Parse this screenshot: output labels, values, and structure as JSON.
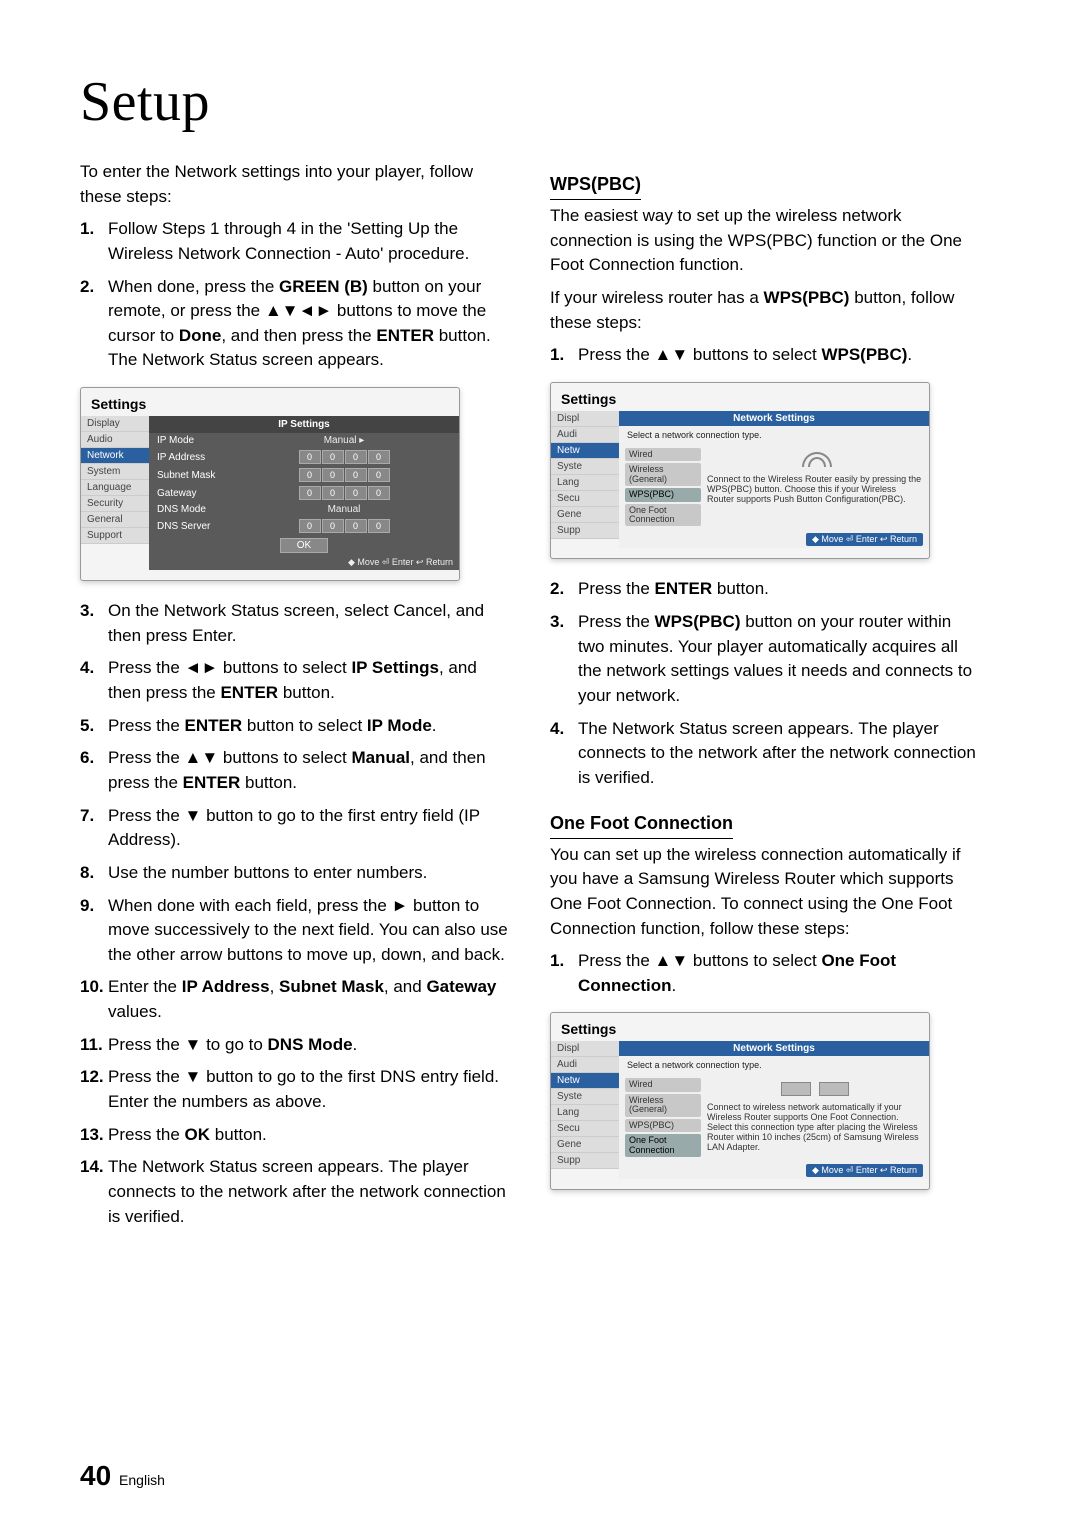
{
  "title": "Setup",
  "footer": {
    "page": "40",
    "lang": "English"
  },
  "left": {
    "intro": "To enter the Network settings into your player, follow these steps:",
    "steps_before": [
      "Follow Steps 1 through 4 in the 'Setting Up the Wireless Network Connection - Auto' procedure.",
      "When done, press the <b>GREEN (B)</b> button on your remote, or press the ▲▼◄► buttons to move the cursor to <b>Done</b>, and then press the <b>ENTER</b> button. The Network Status screen appears."
    ],
    "ip_panel": {
      "title": "Settings",
      "side": [
        "Display",
        "Audio",
        "Network",
        "System",
        "Language",
        "Security",
        "General",
        "Support"
      ],
      "active": 2,
      "pane_title": "IP Settings",
      "rows": [
        {
          "label": "IP Mode",
          "mode": "Manual ▸"
        },
        {
          "label": "IP Address",
          "vals": [
            "0",
            "0",
            "0",
            "0"
          ]
        },
        {
          "label": "Subnet Mask",
          "vals": [
            "0",
            "0",
            "0",
            "0"
          ]
        },
        {
          "label": "Gateway",
          "vals": [
            "0",
            "0",
            "0",
            "0"
          ]
        },
        {
          "label": "DNS Mode",
          "mode": "Manual"
        },
        {
          "label": "DNS Server",
          "vals": [
            "0",
            "0",
            "0",
            "0"
          ]
        }
      ],
      "ok": "OK",
      "hints": "◆ Move   ⏎ Enter   ↩ Return"
    },
    "steps_after": [
      "On the Network Status screen, select Cancel, and then press Enter.",
      "Press the ◄► buttons to select <b>IP Settings</b>, and then press the <b>ENTER</b> button.",
      "Press the <b>ENTER</b> button to select <b>IP Mode</b>.",
      "Press the ▲▼ buttons to select <b>Manual</b>, and then press the <b>ENTER</b> button.",
      "Press the ▼ button to go to the first entry field (IP Address).",
      "Use the number buttons to enter numbers.",
      "When done with each field, press the ► button to move successively to the next field. You can also use the other arrow buttons to move up, down, and back.",
      "Enter the <b>IP Address</b>, <b>Subnet Mask</b>, and <b>Gateway</b> values.",
      "Press the ▼ to go to <b>DNS Mode</b>.",
      "Press the ▼ button to go to the first DNS entry field. Enter the numbers as above.",
      "Press the <b>OK</b> button.",
      "The Network Status screen appears. The player connects to the network after the network connection is verified."
    ]
  },
  "right": {
    "wps": {
      "heading": "WPS(PBC)",
      "p1": "The easiest way to set up the wireless network connection is using the WPS(PBC) function or the One Foot Connection function.",
      "p2": "If your wireless router has a <b>WPS(PBC)</b> button, follow these steps:",
      "steps_before": [
        "Press the ▲▼ buttons to select <b>WPS(PBC)</b>."
      ],
      "panel": {
        "title": "Settings",
        "side": [
          "Displ",
          "Audi",
          "Netw",
          "Syste",
          "Lang",
          "Secu",
          "Gene",
          "Supp"
        ],
        "active": 2,
        "pane_title": "Network Settings",
        "sub": "Select a network connection type.",
        "items": [
          "Wired",
          "Wireless (General)",
          "WPS(PBC)",
          "One Foot Connection"
        ],
        "selected": 2,
        "desc": "Connect to the Wireless Router easily by pressing the WPS(PBC) button. Choose this if your Wireless Router supports Push Button Configuration(PBC).",
        "hints": "◆ Move   ⏎ Enter   ↩ Return"
      },
      "steps_after": [
        "Press the <b>ENTER</b> button.",
        "Press the <b>WPS(PBC)</b> button on your router within two minutes. Your player automatically acquires all the network settings values it needs and connects to your network.",
        "The Network Status screen appears. The player connects to the network after the network connection is verified."
      ]
    },
    "ofc": {
      "heading": "One Foot Connection",
      "p1": "You can set up the wireless connection automatically if you have a Samsung Wireless Router which supports One Foot Connection. To connect using the One Foot Connection function, follow these steps:",
      "steps_before": [
        "Press the ▲▼ buttons to select <b>One Foot Connection</b>."
      ],
      "panel": {
        "title": "Settings",
        "side": [
          "Displ",
          "Audi",
          "Netw",
          "Syste",
          "Lang",
          "Secu",
          "Gene",
          "Supp"
        ],
        "active": 2,
        "pane_title": "Network Settings",
        "sub": "Select a network connection type.",
        "items": [
          "Wired",
          "Wireless (General)",
          "WPS(PBC)",
          "One Foot Connection"
        ],
        "selected": 3,
        "desc": "Connect to wireless network automatically if your Wireless Router supports One Foot Connection. Select this connection type after placing the Wireless Router within 10 inches (25cm) of Samsung Wireless LAN Adapter.",
        "hints": "◆ Move   ⏎ Enter   ↩ Return"
      }
    }
  }
}
